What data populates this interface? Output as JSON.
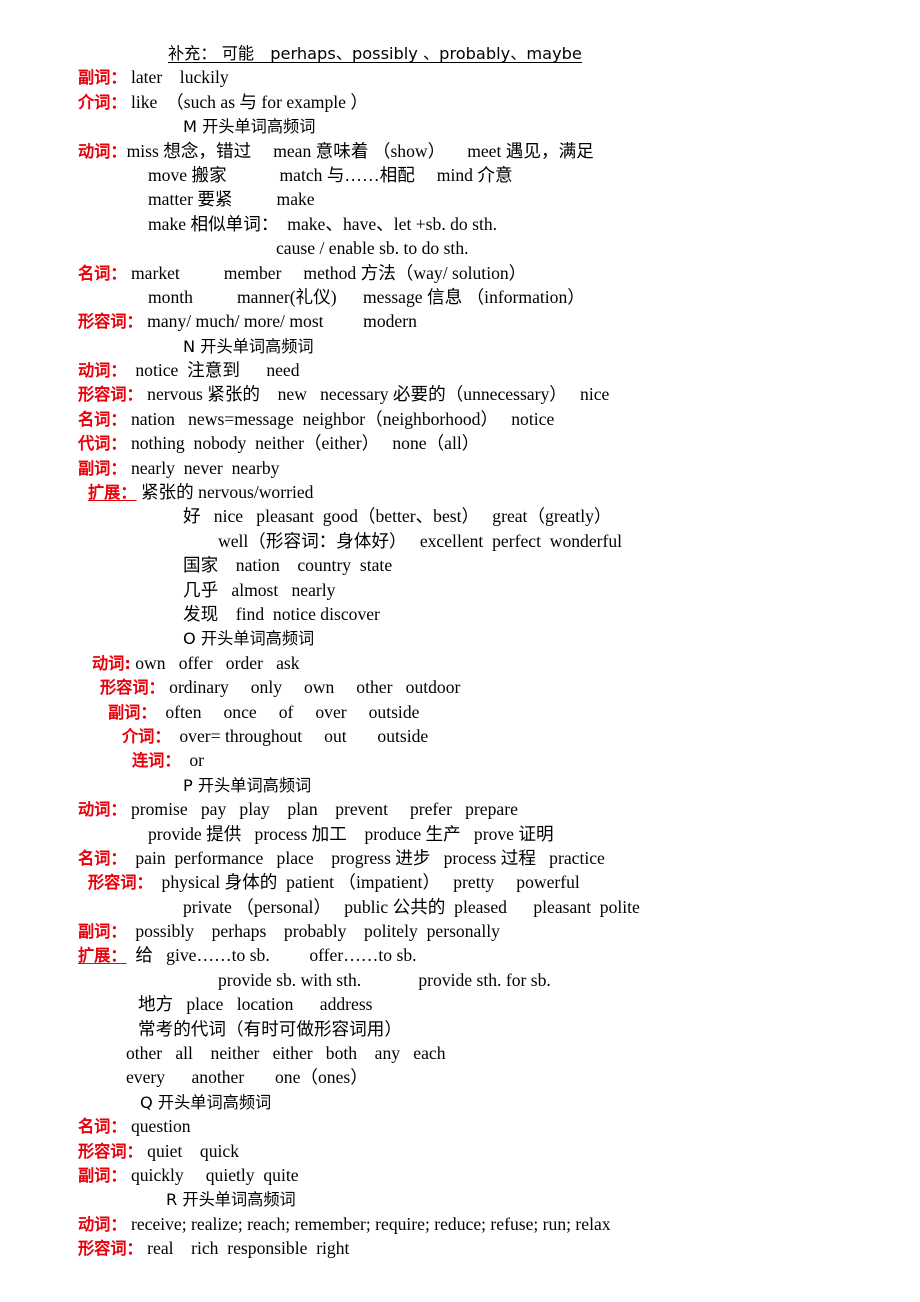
{
  "document": {
    "title_line": "补充： 可能　perhaps、possibly 、probably、maybe",
    "sections": [
      {
        "id": "pre-m",
        "rows": [
          {
            "type": "header-underline",
            "indent": 90,
            "text": "补充： 可能　perhaps、possibly 、probably、maybe"
          },
          {
            "type": "labeled",
            "label": "副词：",
            "indent": 0,
            "text": " later    luckily"
          },
          {
            "type": "labeled",
            "label": "介词：",
            "indent": 0,
            "text": " like  （such as 与 for example ）"
          }
        ]
      },
      {
        "id": "m",
        "heading": "M 开头单词高频词",
        "heading_indent": 105,
        "rows": [
          {
            "type": "labeled",
            "label": "动词：",
            "indent": 0,
            "text": "miss 想念，错过     mean 意味着 （show）     meet 遇见，满足"
          },
          {
            "type": "plain",
            "indent": 70,
            "text": "move 搬家            match 与……相配     mind 介意"
          },
          {
            "type": "plain",
            "indent": 70,
            "text": "matter 要紧          make"
          },
          {
            "type": "plain",
            "indent": 70,
            "text": "make 相似单词：  make、have、let +sb. do sth."
          },
          {
            "type": "plain",
            "indent": 198,
            "text": "cause / enable sb. to do sth."
          },
          {
            "type": "labeled",
            "label": "名词：",
            "indent": 0,
            "text": " market          member     method 方法（way/ solution）"
          },
          {
            "type": "plain",
            "indent": 70,
            "text": "month          manner(礼仪)      message 信息 （information）"
          },
          {
            "type": "labeled",
            "label": "形容词：",
            "indent": 0,
            "text": " many/ much/ more/ most         modern"
          }
        ]
      },
      {
        "id": "n",
        "heading": "N 开头单词高频词",
        "heading_indent": 105,
        "rows": [
          {
            "type": "labeled",
            "label": "动词：",
            "indent": 0,
            "text": "  notice  注意到      need"
          },
          {
            "type": "labeled",
            "label": "形容词：",
            "indent": 0,
            "text": " nervous 紧张的    new   necessary 必要的（unnecessary）   nice"
          },
          {
            "type": "labeled",
            "label": "名词：",
            "indent": 0,
            "text": " nation   news=message  neighbor（neighborhood）   notice"
          },
          {
            "type": "labeled",
            "label": "代词：",
            "indent": 0,
            "text": " nothing  nobody  neither（either）   none（all）"
          },
          {
            "type": "labeled",
            "label": "副词：",
            "indent": 0,
            "text": " nearly  never  nearby"
          },
          {
            "type": "labeled-underline",
            "label": "扩展：",
            "indent": 10,
            "text": " 紧张的 nervous/worried"
          },
          {
            "type": "plain",
            "indent": 105,
            "text": "好   nice   pleasant  good（better、best）   great（greatly）"
          },
          {
            "type": "plain",
            "indent": 140,
            "text": "well（形容词：身体好）   excellent  perfect  wonderful"
          },
          {
            "type": "plain",
            "indent": 105,
            "text": "国家    nation    country  state"
          },
          {
            "type": "plain",
            "indent": 105,
            "text": "几乎   almost   nearly"
          },
          {
            "type": "plain",
            "indent": 105,
            "text": "发现    find  notice discover"
          }
        ]
      },
      {
        "id": "o",
        "heading": "O 开头单词高频词",
        "heading_indent": 105,
        "rows": [
          {
            "type": "labeled",
            "label": "动词:",
            "indent": 14,
            "text": " own   offer   order   ask"
          },
          {
            "type": "labeled",
            "label": "形容词：",
            "indent": 22,
            "text": " ordinary     only     own     other   outdoor"
          },
          {
            "type": "labeled",
            "label": "副词：",
            "indent": 30,
            "text": "  often     once     of     over     outside"
          },
          {
            "type": "labeled",
            "label": "介词：",
            "indent": 44,
            "text": "  over= throughout     out       outside"
          },
          {
            "type": "labeled",
            "label": "连词：",
            "indent": 54,
            "text": "  or"
          }
        ]
      },
      {
        "id": "p",
        "heading": "P 开头单词高频词",
        "heading_indent": 105,
        "rows": [
          {
            "type": "labeled",
            "label": "动词：",
            "indent": 0,
            "text": " promise   pay   play    plan    prevent     prefer   prepare"
          },
          {
            "type": "plain",
            "indent": 70,
            "text": "provide 提供   process 加工    produce 生产   prove 证明"
          },
          {
            "type": "labeled",
            "label": "名词：",
            "indent": 0,
            "text": "  pain  performance   place    progress 进步   process 过程   practice"
          },
          {
            "type": "labeled",
            "label": "形容词：",
            "indent": 10,
            "text": "  physical 身体的  patient （impatient）   pretty     powerful"
          },
          {
            "type": "plain",
            "indent": 105,
            "text": "private （personal）   public 公共的  pleased      pleasant  polite"
          },
          {
            "type": "labeled",
            "label": "副词：",
            "indent": 0,
            "text": "  possibly    perhaps    probably    politely  personally"
          },
          {
            "type": "labeled-underline",
            "label": "扩展：",
            "indent": 0,
            "text": "  给   give……to sb.         offer……to sb."
          },
          {
            "type": "plain",
            "indent": 140,
            "text": "provide sb. with sth.             provide sth. for sb."
          },
          {
            "type": "plain",
            "indent": 60,
            "text": "地方   place   location      address"
          },
          {
            "type": "plain",
            "indent": 60,
            "text": "常考的代词（有时可做形容词用）"
          },
          {
            "type": "plain",
            "indent": 48,
            "text": "other   all    neither   either   both    any   each"
          },
          {
            "type": "plain",
            "indent": 48,
            "text": "every      another       one（ones）"
          }
        ]
      },
      {
        "id": "q",
        "heading": "Q 开头单词高频词",
        "heading_indent": 62,
        "rows": [
          {
            "type": "labeled",
            "label": "名词：",
            "indent": 0,
            "text": " question"
          },
          {
            "type": "labeled",
            "label": "形容词：",
            "indent": 0,
            "text": " quiet    quick"
          },
          {
            "type": "labeled",
            "label": "副词：",
            "indent": 0,
            "text": " quickly     quietly  quite"
          }
        ]
      },
      {
        "id": "r",
        "heading": "R 开头单词高频词",
        "heading_indent": 88,
        "rows": [
          {
            "type": "labeled",
            "label": "动词：",
            "indent": 0,
            "text": " receive; realize; reach; remember; require; reduce; refuse; run; relax"
          },
          {
            "type": "labeled",
            "label": "形容词：",
            "indent": 0,
            "text": " real    rich  responsible  right"
          }
        ]
      }
    ],
    "colors": {
      "label_red": "#e8000b",
      "body_black": "#000000",
      "page_background": "#ffffff"
    }
  }
}
